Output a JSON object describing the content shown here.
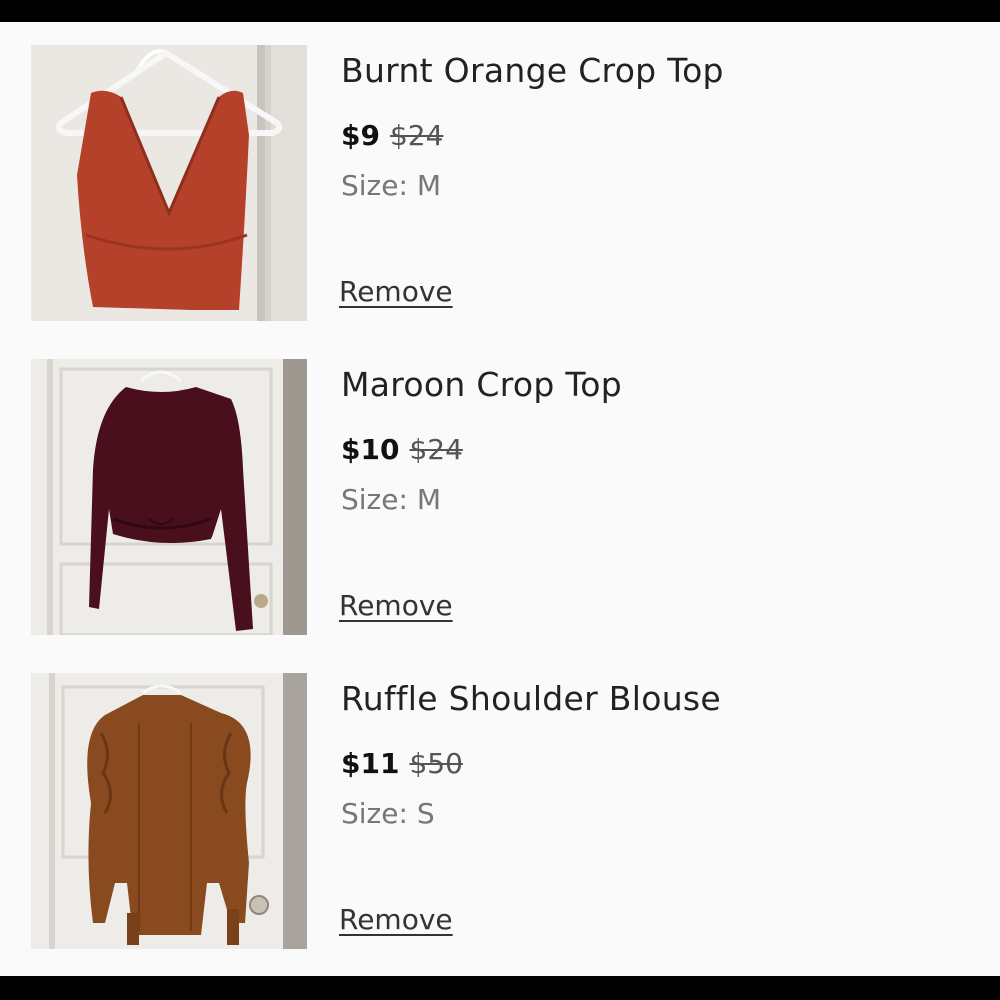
{
  "cart": {
    "items": [
      {
        "title": "Burnt Orange Crop Top",
        "price": "$9",
        "original_price": "$24",
        "size_label": "Size:",
        "size": "M",
        "remove_label": "Remove",
        "image_subject": "burnt orange v-neck crop top on white hanger",
        "garment_color": "#b6412b"
      },
      {
        "title": "Maroon Crop Top",
        "price": "$10",
        "original_price": "$24",
        "size_label": "Size:",
        "size": "M",
        "remove_label": "Remove",
        "image_subject": "maroon long-sleeve crop top hanging on door",
        "garment_color": "#4a0f1c"
      },
      {
        "title": "Ruffle Shoulder Blouse",
        "price": "$11",
        "original_price": "$50",
        "size_label": "Size:",
        "size": "S",
        "remove_label": "Remove",
        "image_subject": "rust brown puff-shoulder blouse hanging on door",
        "garment_color": "#8a4a1f"
      }
    ]
  }
}
